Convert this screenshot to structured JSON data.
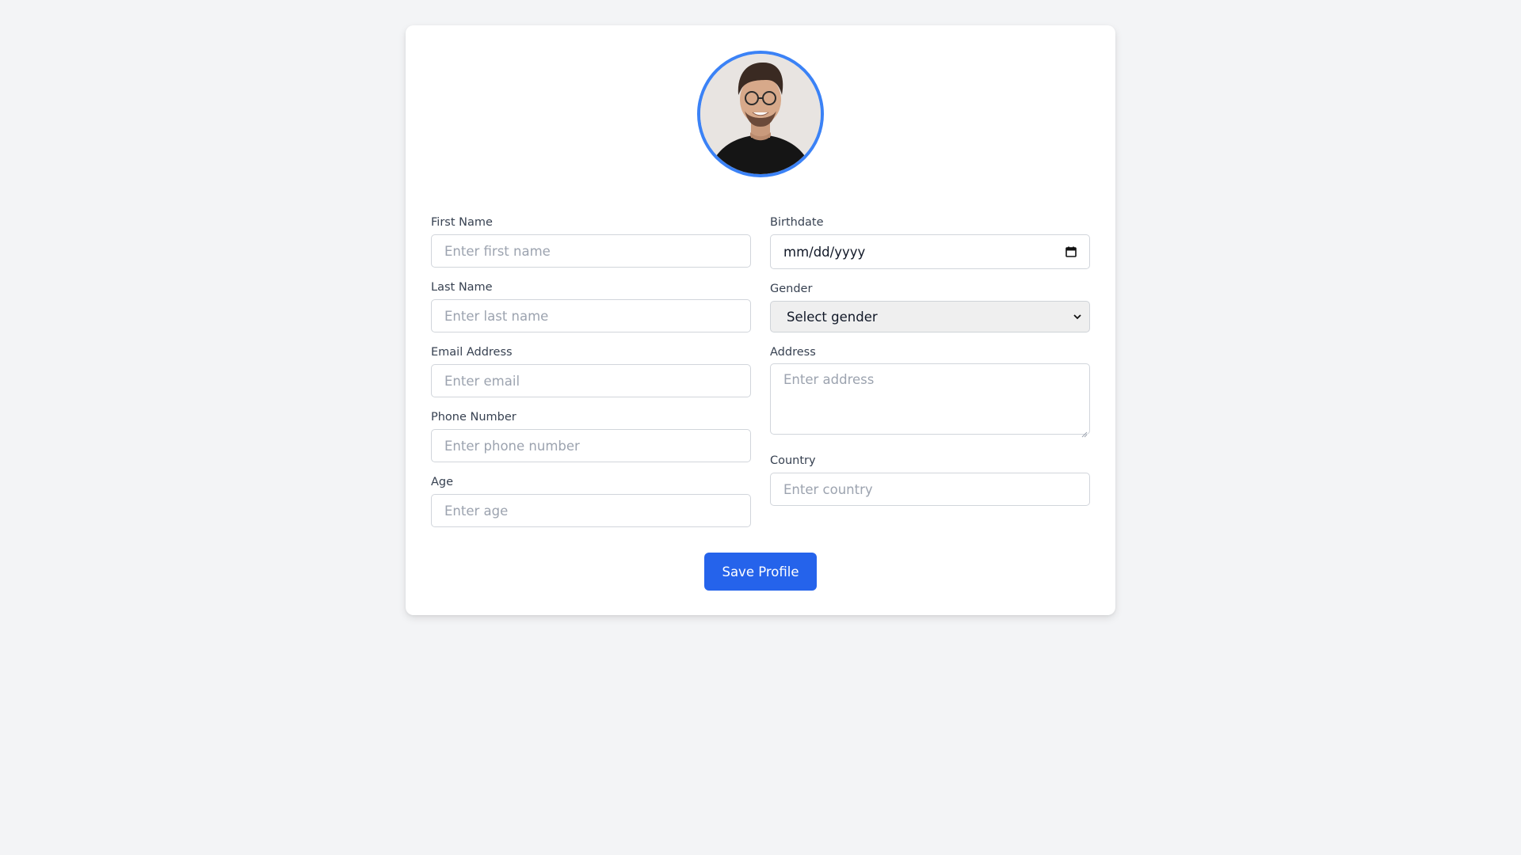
{
  "profile": {
    "avatar_alt": "Profile photo",
    "accent_color": "#3b82f6"
  },
  "form": {
    "left": [
      {
        "key": "first_name",
        "label": "First Name",
        "placeholder": "Enter first name",
        "value": ""
      },
      {
        "key": "last_name",
        "label": "Last Name",
        "placeholder": "Enter last name",
        "value": ""
      },
      {
        "key": "email",
        "label": "Email Address",
        "placeholder": "Enter email",
        "value": ""
      },
      {
        "key": "phone",
        "label": "Phone Number",
        "placeholder": "Enter phone number",
        "value": ""
      },
      {
        "key": "age",
        "label": "Age",
        "placeholder": "Enter age",
        "value": ""
      }
    ],
    "right": {
      "birthdate": {
        "label": "Birthdate",
        "value": "mm/dd/yyyy",
        "icon": "calendar-icon"
      },
      "gender": {
        "label": "Gender",
        "selected": "Select gender",
        "icon": "chevron-down-icon"
      },
      "address": {
        "label": "Address",
        "placeholder": "Enter address",
        "value": ""
      },
      "country": {
        "label": "Country",
        "placeholder": "Enter country",
        "value": ""
      }
    }
  },
  "actions": {
    "save_label": "Save Profile",
    "save_color": "#2563eb"
  }
}
